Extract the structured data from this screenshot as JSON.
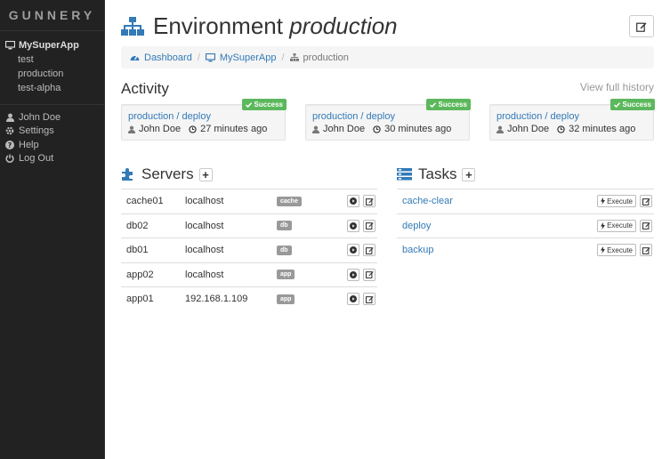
{
  "brand": "GUNNERY",
  "sidebar": {
    "app_name": "MySuperApp",
    "environments": [
      "test",
      "production",
      "test-alpha"
    ],
    "user_items": [
      {
        "label": "John Doe",
        "icon": "user-icon"
      },
      {
        "label": "Settings",
        "icon": "gear-icon"
      },
      {
        "label": "Help",
        "icon": "question-icon"
      },
      {
        "label": "Log Out",
        "icon": "power-icon"
      }
    ]
  },
  "header": {
    "title_prefix": "Environment",
    "title_env": "production"
  },
  "breadcrumb": {
    "dashboard": "Dashboard",
    "app": "MySuperApp",
    "current": "production"
  },
  "activity": {
    "title": "Activity",
    "view_history": "View full history",
    "items": [
      {
        "link": "production / deploy",
        "user": "John Doe",
        "time": "27 minutes ago",
        "status": "Success"
      },
      {
        "link": "production / deploy",
        "user": "John Doe",
        "time": "30 minutes ago",
        "status": "Success"
      },
      {
        "link": "production / deploy",
        "user": "John Doe",
        "time": "32 minutes ago",
        "status": "Success"
      }
    ]
  },
  "servers": {
    "title": "Servers",
    "plus": "+",
    "rows": [
      {
        "name": "cache01",
        "host": "localhost",
        "role": "cache"
      },
      {
        "name": "db02",
        "host": "localhost",
        "role": "db"
      },
      {
        "name": "db01",
        "host": "localhost",
        "role": "db"
      },
      {
        "name": "app02",
        "host": "localhost",
        "role": "app"
      },
      {
        "name": "app01",
        "host": "192.168.1.109",
        "role": "app"
      }
    ]
  },
  "tasks": {
    "title": "Tasks",
    "plus": "+",
    "execute_label": "Execute",
    "rows": [
      {
        "name": "cache-clear"
      },
      {
        "name": "deploy"
      },
      {
        "name": "backup"
      }
    ]
  },
  "colors": {
    "sidebar_bg": "#222222",
    "link": "#337ab7",
    "success": "#5cb85c",
    "role_badge": "#999999"
  }
}
